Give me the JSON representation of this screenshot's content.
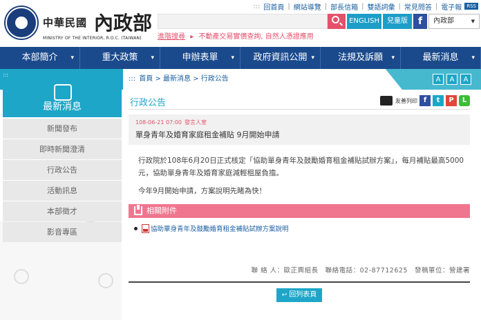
{
  "header": {
    "logo_cn": "中華民國",
    "logo_brand": "內政部",
    "logo_en": "MINISTRY OF THE INTERIOR, R.O.C. (TAIWAN)",
    "toplinks": [
      "回首頁",
      "網站導覽",
      "部長信箱",
      "雙語詞彙",
      "常見問答",
      "電子報"
    ],
    "rss": "RSS",
    "search_placeholder": "",
    "english_label": "ENGLISH",
    "kids_label": "兒童版",
    "select_value": "內政部",
    "ticker_label": "進階搜尋",
    "ticker_text": "不動產交易實價查詢, 自然人憑證應用"
  },
  "nav": [
    "本部簡介",
    "重大政策",
    "申辦表單",
    "政府資訊公開",
    "法規及訴願",
    "最新消息"
  ],
  "breadcrumb": [
    "首頁",
    "最新消息",
    "行政公告"
  ],
  "font_sizes": [
    "A",
    "A",
    "A"
  ],
  "sidebar": {
    "title": "最新消息",
    "items": [
      "新聞發布",
      "即時新聞澄清",
      "行政公告",
      "活動訊息",
      "本部徵才",
      "影音專區"
    ]
  },
  "main": {
    "page_title": "行政公告",
    "share_label": "友善列印",
    "article": {
      "date": "108-06-21 07:00",
      "dept": "發言人室",
      "title": "單身青年及婚育家庭租金補貼 9月開始申請"
    },
    "body": [
      "行政院於108年6月20日正式核定「協助單身青年及鼓勵婚育租金補貼試辦方案」，每月補貼最高5000元，協助單身青年及婚育家庭減輕租屋負擔。",
      "今年9月開始申請，方案說明先睹為快！"
    ],
    "attachments_label": "相關附件",
    "attachments": [
      "協助單身青年及鼓勵婚育租金補貼試辦方案說明"
    ],
    "contact": {
      "person": "聯 絡 人：歐正興組長",
      "phone": "聯絡電話：02-87712625",
      "unit": "發稿單位：營建署"
    },
    "back_label": "回列表頁"
  },
  "colors": {
    "nav": "#1a4a8c",
    "accent": "#1da6c8",
    "pink": "#e5506a",
    "attach": "#f0758f"
  }
}
